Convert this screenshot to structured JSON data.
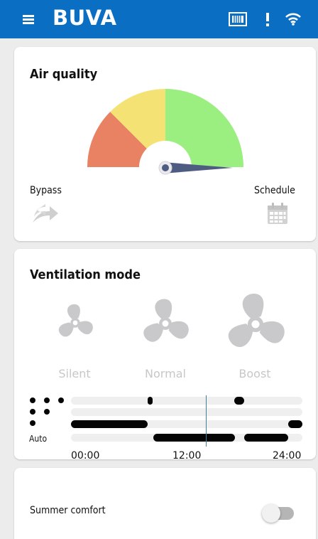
{
  "app": {
    "brand": "BUVA"
  },
  "colors": {
    "header": "#0a6fc2",
    "gauge_red": "#e98262",
    "gauge_yellow": "#f4e374",
    "gauge_green": "#9bef80",
    "needle": "#4f5c82"
  },
  "air_quality": {
    "title": "Air quality",
    "bypass_label": "Bypass",
    "schedule_label": "Schedule",
    "gauge_level": 0.97
  },
  "ventilation": {
    "title": "Ventilation mode",
    "modes": [
      "Silent",
      "Normal",
      "Boost"
    ],
    "auto_label": "Auto",
    "times": [
      "00:00",
      "12:00",
      "24:00"
    ]
  },
  "summer_comfort": {
    "label": "Summer comfort",
    "enabled": false
  },
  "icons": [
    "menu-icon",
    "filter-icon",
    "alert-icon",
    "wifi-icon",
    "bypass-arrows-icon",
    "calendar-icon",
    "fan-icon"
  ]
}
